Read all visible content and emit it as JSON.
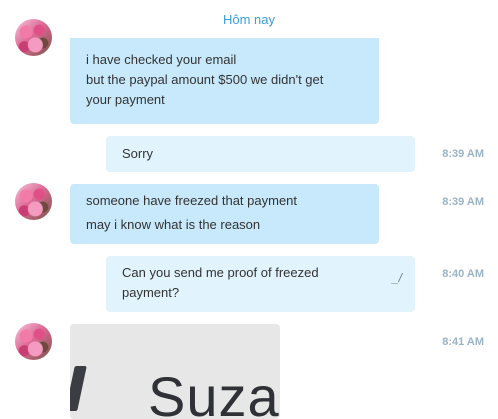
{
  "header": {
    "date_label": "Hôm nay"
  },
  "messages": [
    {
      "type": "incoming",
      "lines": [
        "i have checked your email",
        "but the paypal amount $500 we didn't get",
        "your payment"
      ]
    },
    {
      "type": "outgoing",
      "lines": [
        "Sorry"
      ],
      "time": "8:39 AM"
    },
    {
      "type": "incoming",
      "lines": [
        "someone have freezed that payment",
        "may i know what is the reason"
      ],
      "time": "8:39 AM"
    },
    {
      "type": "outgoing",
      "lines": [
        "Can you send me proof of freezed",
        "payment?"
      ],
      "time": "8:40 AM",
      "edited_icon": "edit-icon"
    },
    {
      "type": "incoming-image",
      "image_text": "Suza",
      "time": "8:41 AM"
    }
  ]
}
